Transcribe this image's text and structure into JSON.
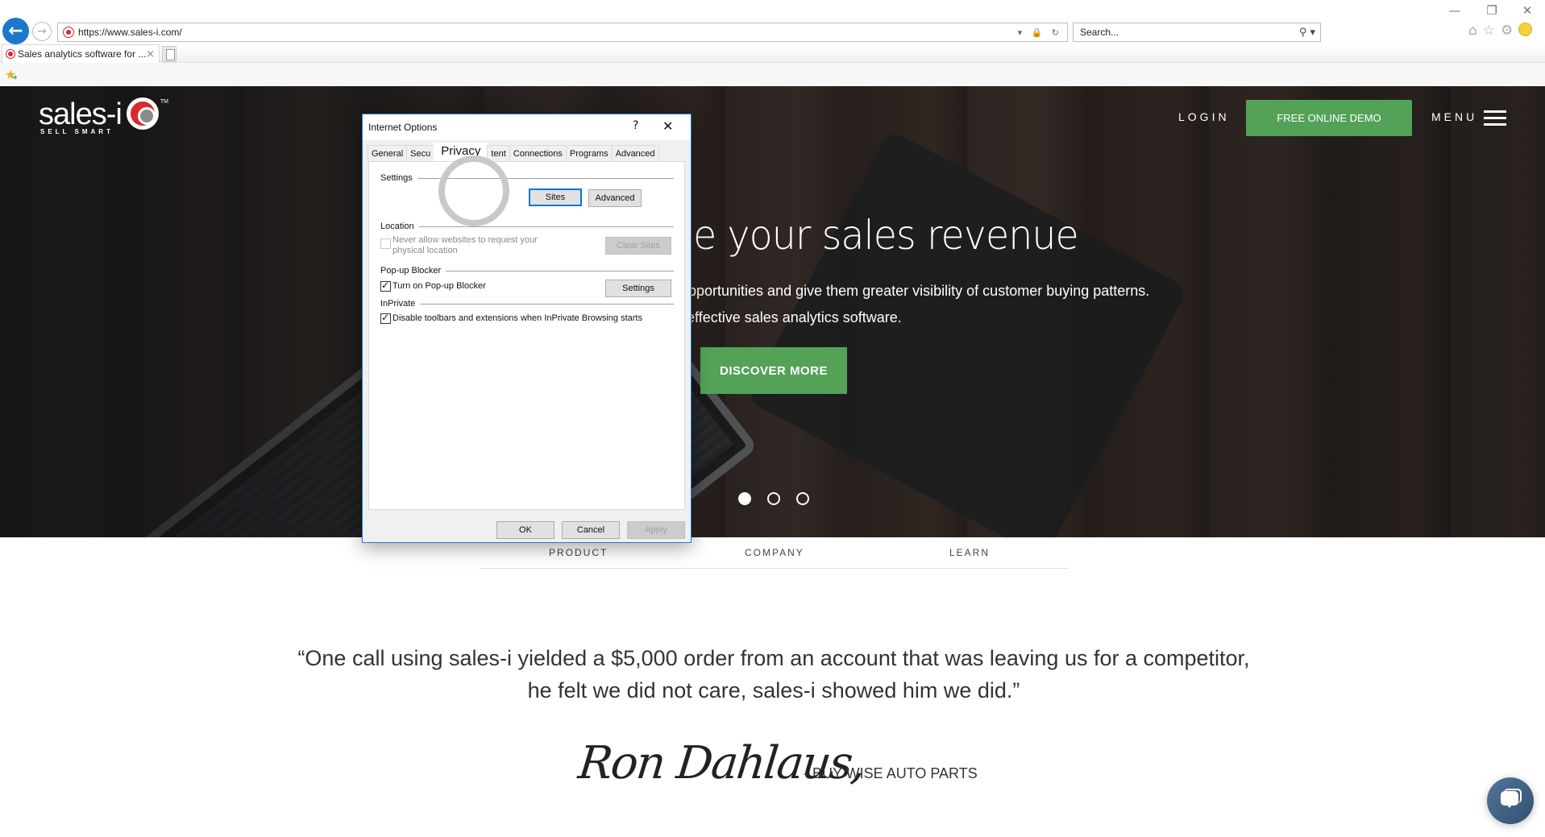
{
  "browser": {
    "window_controls": {
      "minimize": "—",
      "restore": "❐",
      "close": "✕"
    },
    "back_icon": "←",
    "forward_icon": "→",
    "url": "https://www.sales-i.com/",
    "address_icons": "▾ 🔒 ↻",
    "search_placeholder": "Search...",
    "search_icon": "⚲ ▾",
    "toolbar_icons": {
      "home": "⌂",
      "favorites": "☆",
      "settings": "⚙"
    },
    "tab": {
      "title": "Sales analytics software for ...",
      "close": "×"
    },
    "favorites_bar_icon": "★"
  },
  "site": {
    "logo": {
      "word": "sales-i",
      "tagline": "SELL SMART",
      "tm": "TM"
    },
    "header": {
      "login": "LOGIN",
      "demo": "FREE ONLINE DEMO",
      "menu": "MENU"
    },
    "hero": {
      "title": "e your sales revenue",
      "line1": "pportunities and give them greater visibility of customer buying patterns.",
      "line2": "effective sales analytics software.",
      "cta": "DISCOVER MORE",
      "slides": [
        {
          "active": true
        },
        {
          "active": false
        },
        {
          "active": false
        }
      ]
    },
    "subnav": [
      "PRODUCT",
      "COMPANY",
      "LEARN"
    ],
    "testimonial": {
      "quote": "“One call using sales-i yielded a $5,000 order from an account that was leaving us for a competitor, he felt we did not care, sales-i showed him we did.”",
      "signature": "Ron Dahlaus,",
      "company": "- BUY WISE AUTO PARTS"
    },
    "colors": {
      "green": "#53a258",
      "chat": "#46658a"
    }
  },
  "dialog": {
    "title": "Internet Options",
    "help": "?",
    "close": "✕",
    "tabs": [
      {
        "label": "General",
        "active": false
      },
      {
        "label": "Secu",
        "active": false
      },
      {
        "label": "Privacy",
        "active": true
      },
      {
        "label": "tent",
        "active": false
      },
      {
        "label": "Connections",
        "active": false
      },
      {
        "label": "Programs",
        "active": false
      },
      {
        "label": "Advanced",
        "active": false
      }
    ],
    "groups": {
      "settings": "Settings",
      "location": "Location",
      "popup": "Pop-up Blocker",
      "inprivate": "InPrivate"
    },
    "buttons": {
      "sites": "Sites",
      "advanced": "Advanced",
      "clear_sites": "Clear Sites",
      "popup_settings": "Settings",
      "ok": "OK",
      "cancel": "Cancel",
      "apply": "Apply"
    },
    "checkboxes": {
      "location": {
        "label": "Never allow websites to request your physical location",
        "checked": false,
        "disabled": true
      },
      "popup": {
        "label": "Turn on Pop-up Blocker",
        "checked": true
      },
      "inprivate": {
        "label": "Disable toolbars and extensions when InPrivate Browsing starts",
        "checked": true
      }
    }
  }
}
